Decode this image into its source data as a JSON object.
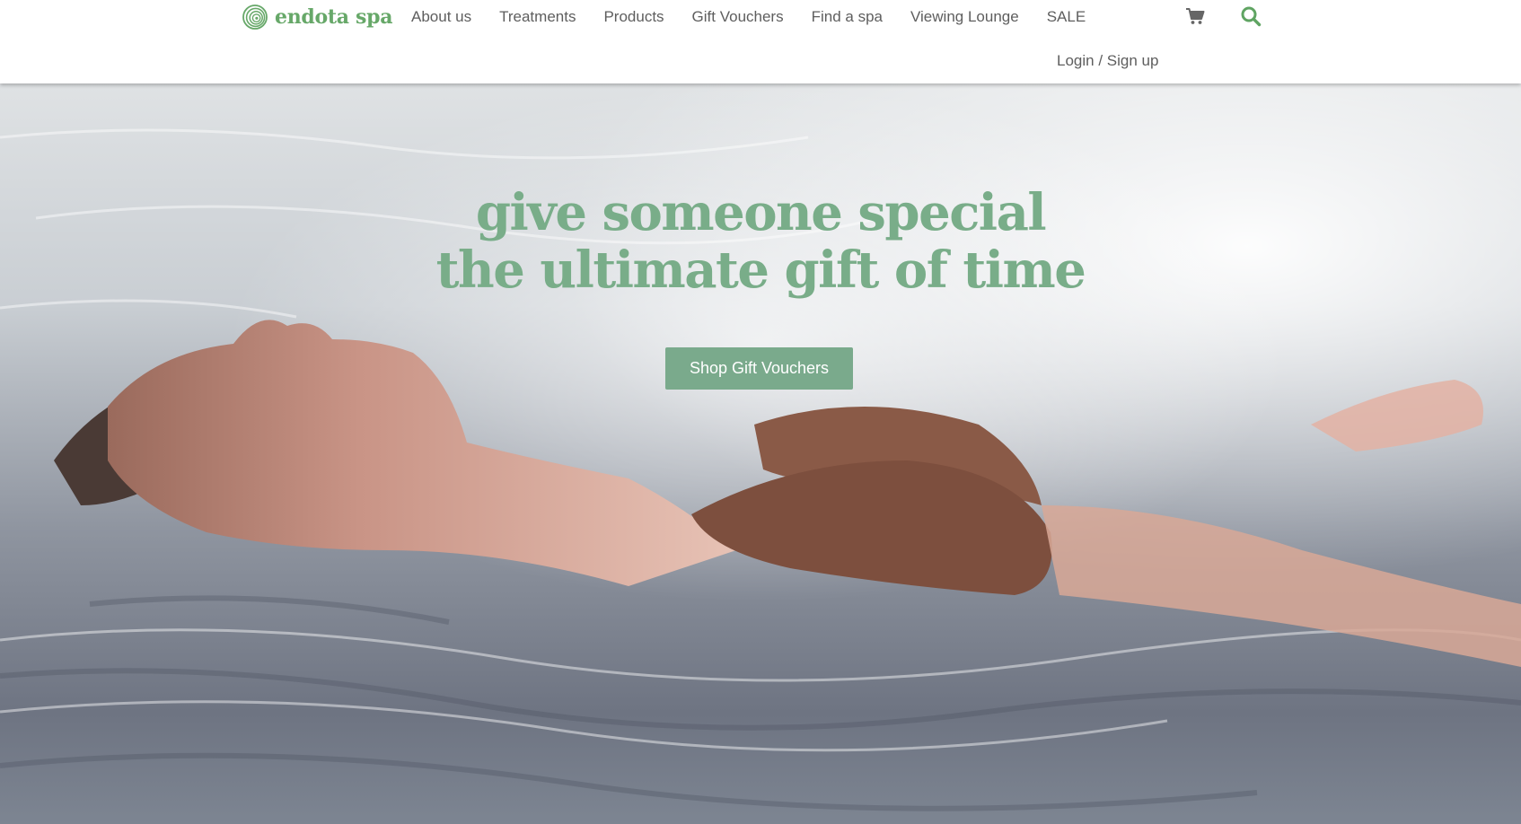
{
  "brand": {
    "name": "endota spa",
    "color": "#67a869"
  },
  "nav": {
    "items": [
      {
        "label": "About us"
      },
      {
        "label": "Treatments"
      },
      {
        "label": "Products"
      },
      {
        "label": "Gift Vouchers"
      },
      {
        "label": "Find a spa"
      },
      {
        "label": "Viewing Lounge"
      },
      {
        "label": "SALE"
      }
    ],
    "text_color": "#5e5e5e"
  },
  "header_icons": {
    "cart": "cart-icon",
    "search": "search-icon"
  },
  "account": {
    "login_label": "Login / Sign up"
  },
  "hero": {
    "headline_line1": "give someone special",
    "headline_line2": "the ultimate gift of time",
    "headline_color": "#79ad89",
    "cta_label": "Shop Gift Vouchers",
    "cta_color": "#7aaa8c"
  }
}
